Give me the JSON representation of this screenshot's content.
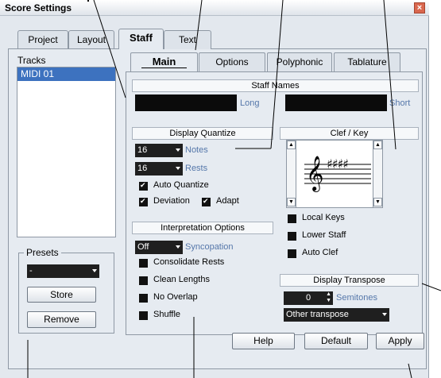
{
  "window": {
    "title": "Score Settings",
    "close_icon": "close-icon"
  },
  "outer_tabs": [
    "Project",
    "Layout",
    "Staff",
    "Text"
  ],
  "left": {
    "tracks_label": "Tracks",
    "tracks": [
      "MIDI 01"
    ],
    "presets_label": "Presets",
    "preset_value": "-",
    "store_label": "Store",
    "remove_label": "Remove"
  },
  "inner_tabs": [
    "Main",
    "Options",
    "Polyphonic",
    "Tablature"
  ],
  "staff_names": {
    "header": "Staff Names",
    "long_label": "Long",
    "short_label": "Short"
  },
  "display_quantize": {
    "header": "Display Quantize",
    "notes_value": "16",
    "notes_label": "Notes",
    "rests_value": "16",
    "rests_label": "Rests",
    "auto_quantize": "Auto Quantize",
    "deviation": "Deviation",
    "adapt": "Adapt"
  },
  "clef_key": {
    "header": "Clef / Key",
    "local_keys": "Local Keys",
    "lower_staff": "Lower Staff",
    "auto_clef": "Auto Clef",
    "clef_glyph": "𝄞",
    "key_glyph": "♯♯♯♯"
  },
  "interpretation": {
    "header": "Interpretation Options",
    "syncopation_value": "Off",
    "syncopation_label": "Syncopation",
    "consolidate_rests": "Consolidate Rests",
    "clean_lengths": "Clean Lengths",
    "no_overlap": "No Overlap",
    "shuffle": "Shuffle"
  },
  "display_transpose": {
    "header": "Display Transpose",
    "semitones_value": "0",
    "semitones_label": "Semitones",
    "transpose_value": "Other transpose"
  },
  "buttons": {
    "help": "Help",
    "default": "Default",
    "apply": "Apply"
  },
  "colors": {
    "selection": "#3d72bf",
    "field_black": "#0b0b0b",
    "label_blue": "#5577aa"
  }
}
